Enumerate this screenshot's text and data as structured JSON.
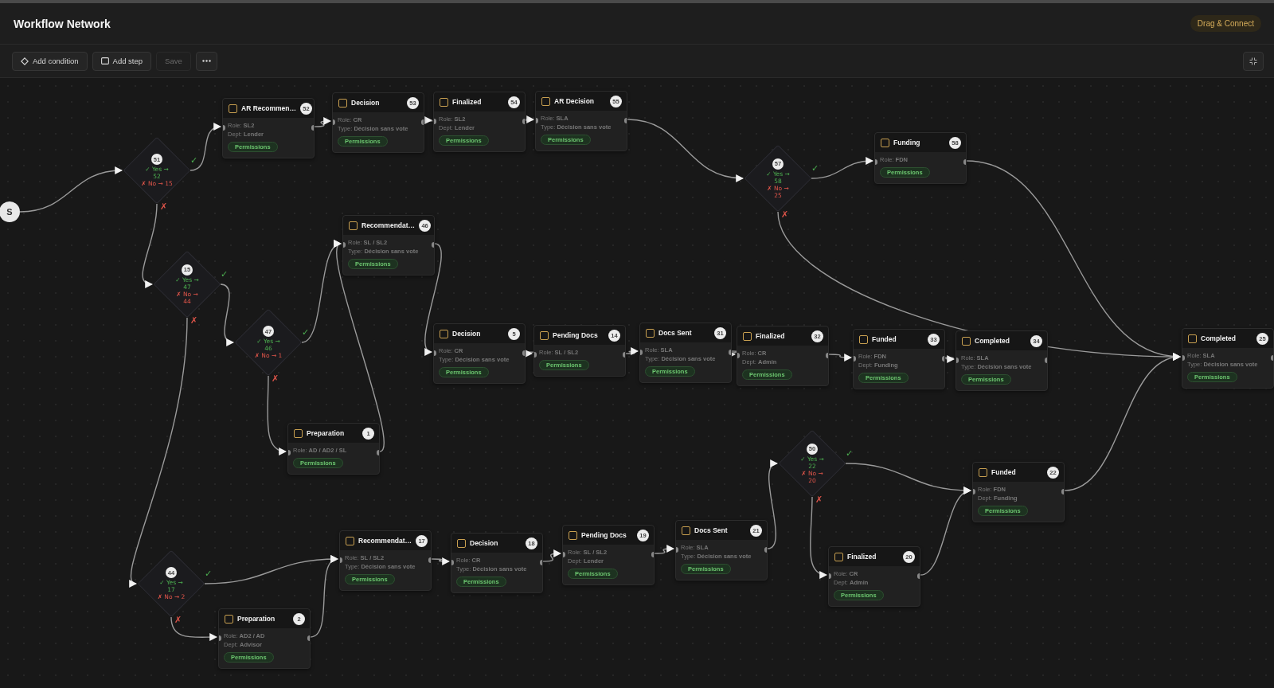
{
  "header": {
    "title": "Workflow Network",
    "mode_badge": "Drag & Connect"
  },
  "toolbar": [
    {
      "label": "Add condition",
      "disabled": false
    },
    {
      "label": "Add step",
      "disabled": false
    },
    {
      "label": "Save",
      "disabled": true
    }
  ],
  "nodes": [
    {
      "kind": "start",
      "label": "S"
    },
    {
      "kind": "decision",
      "number": "51",
      "yes": "✓ Yes →",
      "yes_target": "52",
      "no": "✗ No → 15",
      "yes_mark": "✓",
      "no_mark": "✗"
    },
    {
      "kind": "step",
      "number": "52",
      "title": "AR Recommen…",
      "fields": [
        "Role: **SL2**",
        "Dept: **Lender**"
      ],
      "tag": "Permissions"
    },
    {
      "kind": "step",
      "number": "53",
      "title": "Decision",
      "fields": [
        "Role: **CR**",
        "Type: **Décision sans vote**"
      ],
      "tag": "Permissions"
    },
    {
      "kind": "step",
      "number": "54",
      "title": "Finalized",
      "fields": [
        "Role: **SL2**",
        "Dept: **Lender**"
      ],
      "tag": "Permissions"
    },
    {
      "kind": "step",
      "number": "55",
      "title": "AR Decision",
      "fields": [
        "Role: **SLA**",
        "Type: **Décision sans vote**"
      ],
      "tag": "Permissions"
    },
    {
      "kind": "decision",
      "number": "57",
      "yes": "✓ Yes →",
      "yes_target": "58",
      "no": "✗ No →",
      "no_target": "25",
      "yes_mark": "✓",
      "no_mark": "✗"
    },
    {
      "kind": "step",
      "number": "58",
      "title": "Funding",
      "fields": [
        "Role: **FDN**"
      ],
      "tag": "Permissions"
    },
    {
      "kind": "decision",
      "number": "15",
      "yes": "✓ Yes →",
      "yes_target": "47",
      "no": "✗ No →",
      "no_target": "44",
      "yes_mark": "✓",
      "no_mark": "✗"
    },
    {
      "kind": "step",
      "number": "46",
      "title": "Recommendat…",
      "fields": [
        "Role: **SL / SL2**",
        "Type: **Décision sans vote**"
      ],
      "tag": "Permissions"
    },
    {
      "kind": "decision",
      "number": "47",
      "yes": "✓ Yes →",
      "yes_target": "46",
      "no": "✗ No → 1",
      "yes_mark": "✓",
      "no_mark": "✗"
    },
    {
      "kind": "step",
      "number": "5",
      "title": "Decision",
      "fields": [
        "Role: **CR**",
        "Type: **Décision sans vote**"
      ],
      "tag": "Permissions"
    },
    {
      "kind": "step",
      "number": "14",
      "title": "Pending Docs",
      "fields": [
        "Role: **SL / SL2**"
      ],
      "tag": "Permissions"
    },
    {
      "kind": "step",
      "number": "31",
      "title": "Docs Sent",
      "fields": [
        "Role: **SLA**",
        "Type: **Décision sans vote**"
      ],
      "tag": "Permissions"
    },
    {
      "kind": "step",
      "number": "32",
      "title": "Finalized",
      "fields": [
        "Role: **CR**",
        "Dept: **Admin**"
      ],
      "tag": "Permissions"
    },
    {
      "kind": "step",
      "number": "33",
      "title": "Funded",
      "fields": [
        "Role: **FDN**",
        "Dept: **Funding**"
      ],
      "tag": "Permissions"
    },
    {
      "kind": "step",
      "number": "34",
      "title": "Completed",
      "fields": [
        "Role: **SLA**",
        "Type: **Décision sans vote**"
      ],
      "tag": "Permissions"
    },
    {
      "kind": "step",
      "number": "25",
      "title": "Completed",
      "fields": [
        "Role: **SLA**",
        "Type: **Décision sans vote**"
      ],
      "tag": "Permissions"
    },
    {
      "kind": "step",
      "number": "1",
      "title": "Preparation",
      "fields": [
        "Role: **AD / AD2 / SL**"
      ],
      "tag": "Permissions"
    },
    {
      "kind": "decision",
      "number": "50",
      "yes": "✓ Yes →",
      "yes_target": "22",
      "no": "✗ No →",
      "no_target": "20",
      "yes_mark": "✓",
      "no_mark": "✗"
    },
    {
      "kind": "step",
      "number": "22",
      "title": "Funded",
      "fields": [
        "Role: **FDN**",
        "Dept: **Funding**"
      ],
      "tag": "Permissions"
    },
    {
      "kind": "step",
      "number": "17",
      "title": "Recommendat…",
      "fields": [
        "Role: **SL / SL2**",
        "Type: **Décision sans vote**"
      ],
      "tag": "Permissions"
    },
    {
      "kind": "step",
      "number": "18",
      "title": "Decision",
      "fields": [
        "Role: **CR**",
        "Type: **Décision sans vote**"
      ],
      "tag": "Permissions"
    },
    {
      "kind": "step",
      "number": "19",
      "title": "Pending Docs",
      "fields": [
        "Role: **SL / SL2**",
        "Dept: **Lender**"
      ],
      "tag": "Permissions"
    },
    {
      "kind": "step",
      "number": "21",
      "title": "Docs Sent",
      "fields": [
        "Role: **SLA**",
        "Type: **Décision sans vote**"
      ],
      "tag": "Permissions"
    },
    {
      "kind": "step",
      "number": "20",
      "title": "Finalized",
      "fields": [
        "Role: **CR**",
        "Dept: **Admin**"
      ],
      "tag": "Permissions"
    },
    {
      "kind": "decision",
      "number": "44",
      "yes": "✓ Yes →",
      "yes_target": "17",
      "no": "✗ No → 2",
      "yes_mark": "✓",
      "no_mark": "✗"
    },
    {
      "kind": "step",
      "number": "2",
      "title": "Preparation",
      "fields": [
        "Role: **AD2 / AD**",
        "Dept: **Advisor**"
      ],
      "tag": "Permissions"
    }
  ]
}
